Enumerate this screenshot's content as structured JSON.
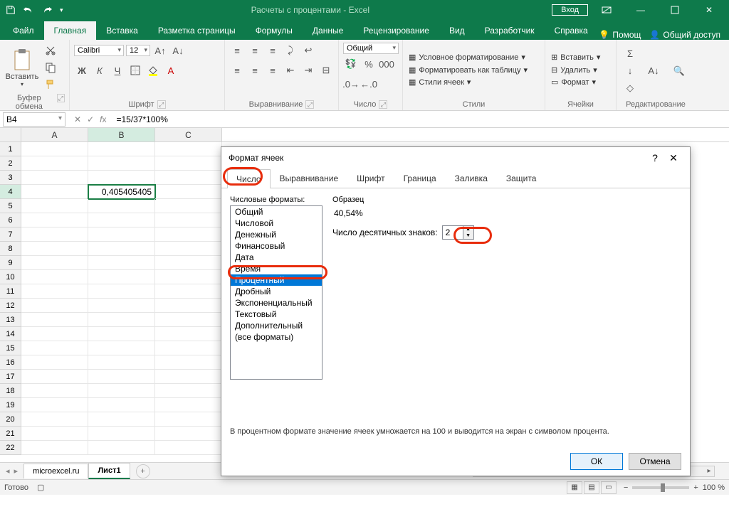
{
  "title": "Расчеты с процентами  -  Excel",
  "signin": "Вход",
  "tabs": [
    "Файл",
    "Главная",
    "Вставка",
    "Разметка страницы",
    "Формулы",
    "Данные",
    "Рецензирование",
    "Вид",
    "Разработчик",
    "Справка"
  ],
  "help_label": "Помощ",
  "share_label": "Общий доступ",
  "ribbon": {
    "clipboard": {
      "label": "Буфер обмена",
      "paste": "Вставить"
    },
    "font": {
      "label": "Шрифт",
      "name": "Calibri",
      "size": "12"
    },
    "alignment": {
      "label": "Выравнивание"
    },
    "number": {
      "label": "Число",
      "format": "Общий"
    },
    "styles": {
      "label": "Стили",
      "cond": "Условное форматирование",
      "table": "Форматировать как таблицу",
      "cell": "Стили ячеек"
    },
    "cells": {
      "label": "Ячейки",
      "insert": "Вставить",
      "delete": "Удалить",
      "format": "Формат"
    },
    "editing": {
      "label": "Редактирование"
    }
  },
  "namebox": "B4",
  "formula": "=15/37*100%",
  "columns": [
    "A",
    "B",
    "C"
  ],
  "rows": [
    1,
    2,
    3,
    4,
    5,
    6,
    7,
    8,
    9,
    10,
    11,
    12,
    13,
    14,
    15,
    16,
    17,
    18,
    19,
    20,
    21,
    22
  ],
  "cell_value": "0,405405405",
  "sheets": {
    "s1": "microexcel.ru",
    "s2": "Лист1"
  },
  "status": "Готово",
  "zoom": "100 %",
  "dialog": {
    "title": "Формат ячеек",
    "tabs": [
      "Число",
      "Выравнивание",
      "Шрифт",
      "Граница",
      "Заливка",
      "Защита"
    ],
    "list_label": "Числовые форматы:",
    "formats": [
      "Общий",
      "Числовой",
      "Денежный",
      "Финансовый",
      "Дата",
      "Время",
      "Процентный",
      "Дробный",
      "Экспоненциальный",
      "Текстовый",
      "Дополнительный",
      "(все форматы)"
    ],
    "sample_label": "Образец",
    "sample_value": "40,54%",
    "decimals_label": "Число десятичных знаков:",
    "decimals_value": "2",
    "description": "В процентном формате значение ячеек умножается на 100 и выводится на экран с символом процента.",
    "ok": "ОК",
    "cancel": "Отмена"
  }
}
